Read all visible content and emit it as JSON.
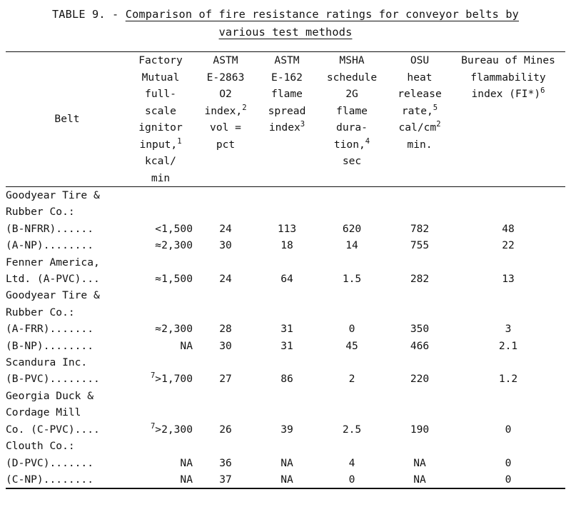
{
  "title": {
    "label": "TABLE 9. - ",
    "line1": "Comparison of fire resistance ratings for conveyor belts by",
    "line2": "various test methods"
  },
  "table": {
    "columns": [
      {
        "key": "belt",
        "header_lines": [
          "Belt"
        ]
      },
      {
        "key": "fm_ignitor",
        "header_lines": [
          "Factory",
          "Mutual",
          "full-",
          "scale",
          "ignitor",
          "input,",
          "kcal/",
          "min"
        ],
        "footnote": "1",
        "footnote_on_line": 6
      },
      {
        "key": "astm_e2863",
        "header_lines": [
          "ASTM",
          "E-2863",
          "O2",
          "index,",
          "vol =",
          "pct"
        ],
        "footnote": "2",
        "footnote_on_line": 4
      },
      {
        "key": "astm_e162",
        "header_lines": [
          "ASTM",
          "E-162",
          "flame",
          "spread",
          "index"
        ],
        "footnote": "3",
        "footnote_on_line": 5
      },
      {
        "key": "msha_2g",
        "header_lines": [
          "MSHA",
          "schedule",
          "2G",
          "flame",
          "dura-",
          "tion,",
          "sec"
        ],
        "footnote": "4",
        "footnote_on_line": 6
      },
      {
        "key": "osu_heat",
        "header_lines": [
          "OSU",
          "heat",
          "release",
          "rate,",
          "cal/cm",
          "min."
        ],
        "footnote": "5",
        "footnote_on_line": 4,
        "footnote2": "2",
        "footnote2_on_line": 5
      },
      {
        "key": "bom_fi",
        "header_lines": [
          "Bureau of Mines",
          "flammability",
          "index (FI*)"
        ],
        "footnote": "6",
        "footnote_on_line": 3
      }
    ],
    "groups": [
      {
        "heading_lines": [
          "Goodyear Tire &",
          "Rubber Co.:"
        ],
        "rows": [
          {
            "label": "(B-NFRR)......",
            "fm_sup": "",
            "fm": "<1,500",
            "astm_e2863": "24",
            "astm_e162": "113",
            "msha_2g": "620",
            "osu_heat": "782",
            "bom_fi": "48"
          },
          {
            "label": "(A-NP)........",
            "fm_sup": "",
            "fm": "≈2,300",
            "astm_e2863": "30",
            "astm_e162": "18",
            "msha_2g": "14",
            "osu_heat": "755",
            "bom_fi": "22"
          }
        ]
      },
      {
        "heading_lines": [
          "Fenner America,"
        ],
        "rows": [
          {
            "label": "Ltd. (A-PVC)...",
            "indent": 1,
            "fm_sup": "",
            "fm": "≈1,500",
            "astm_e2863": "24",
            "astm_e162": "64",
            "msha_2g": "1.5",
            "osu_heat": "282",
            "bom_fi": "13"
          }
        ]
      },
      {
        "heading_lines": [
          "Goodyear Tire &",
          "Rubber Co.:"
        ],
        "rows": [
          {
            "label": "(A-FRR).......",
            "fm_sup": "",
            "fm": "≈2,300",
            "astm_e2863": "28",
            "astm_e162": "31",
            "msha_2g": "0",
            "osu_heat": "350",
            "bom_fi": "3"
          },
          {
            "label": "(B-NP)........",
            "fm_sup": "",
            "fm": "NA",
            "astm_e2863": "30",
            "astm_e162": "31",
            "msha_2g": "45",
            "osu_heat": "466",
            "bom_fi": "2.1"
          }
        ]
      },
      {
        "heading_lines": [
          "Scandura Inc."
        ],
        "rows": [
          {
            "label": "(B-PVC)........",
            "fm_sup": "7",
            "fm": ">1,700",
            "astm_e2863": "27",
            "astm_e162": "86",
            "msha_2g": "2",
            "osu_heat": "220",
            "bom_fi": "1.2"
          }
        ]
      },
      {
        "heading_lines": [
          "Georgia Duck &",
          "Cordage Mill"
        ],
        "rows": [
          {
            "label": "Co. (C-PVC)....",
            "indent": 1,
            "fm_sup": "7",
            "fm": ">2,300",
            "astm_e2863": "26",
            "astm_e162": "39",
            "msha_2g": "2.5",
            "osu_heat": "190",
            "bom_fi": "0"
          }
        ]
      },
      {
        "heading_lines": [
          "Clouth Co.:"
        ],
        "rows": [
          {
            "label": "(D-PVC).......",
            "fm_sup": "",
            "fm": "NA",
            "astm_e2863": "36",
            "astm_e162": "NA",
            "msha_2g": "4",
            "osu_heat": "NA",
            "bom_fi": "0"
          },
          {
            "label": "(C-NP)........",
            "fm_sup": "",
            "fm": "NA",
            "astm_e2863": "37",
            "astm_e162": "NA",
            "msha_2g": "0",
            "osu_heat": "NA",
            "bom_fi": "0"
          }
        ]
      }
    ]
  }
}
